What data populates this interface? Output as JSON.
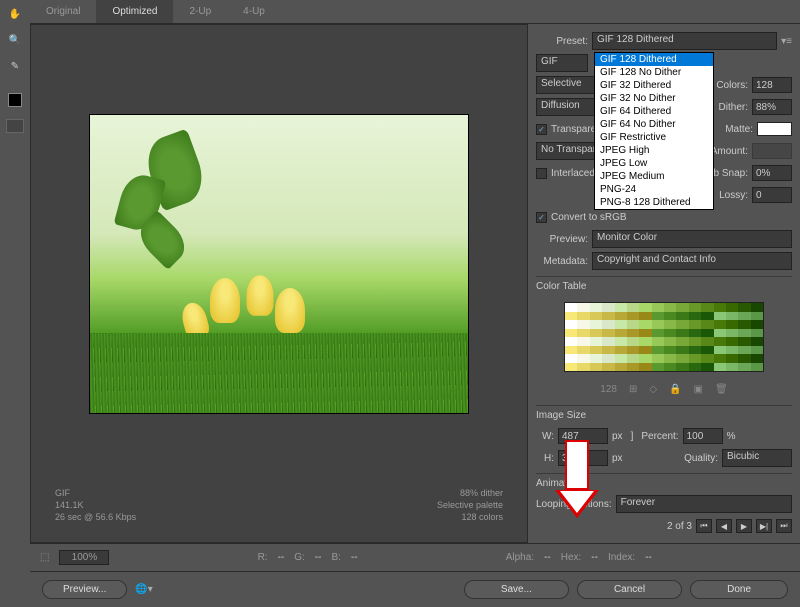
{
  "tabs": [
    "Original",
    "Optimized",
    "2-Up",
    "4-Up"
  ],
  "active_tab": "Optimized",
  "preset": {
    "label": "Preset:",
    "value": "GIF 128 Dithered",
    "options": [
      "GIF 128 Dithered",
      "GIF 128 No Dither",
      "GIF 32 Dithered",
      "GIF 32 No Dither",
      "GIF 64 Dithered",
      "GIF 64 No Dither",
      "GIF Restrictive",
      "JPEG High",
      "JPEG Low",
      "JPEG Medium",
      "PNG-24",
      "PNG-8 128 Dithered"
    ]
  },
  "format_label": "GIF",
  "palette": {
    "label": "Selective",
    "colors_label": "Colors:",
    "colors": "128"
  },
  "dither": {
    "label": "Diffusion",
    "dither_label": "Dither:",
    "value": "88%"
  },
  "transparency": {
    "label": "Transparency",
    "checked": true,
    "matte_label": "Matte:"
  },
  "transparency_dither": {
    "label": "No Transparency Dither",
    "amount_label": "Amount:"
  },
  "interlaced": {
    "label": "Interlaced",
    "checked": false,
    "websnap_label": "Web Snap:",
    "websnap": "0%"
  },
  "lossy": {
    "label": "Lossy:",
    "value": "0"
  },
  "srgb": {
    "label": "Convert to sRGB",
    "checked": true
  },
  "preview": {
    "label": "Preview:",
    "value": "Monitor Color"
  },
  "metadata": {
    "label": "Metadata:",
    "value": "Copyright and Contact Info"
  },
  "color_table": {
    "title": "Color Table",
    "count": "128"
  },
  "image_size": {
    "title": "Image Size",
    "w_label": "W:",
    "w": "487",
    "px": "px",
    "h_label": "H:",
    "h": "368",
    "percent_label": "Percent:",
    "percent": "100",
    "percent_unit": "%",
    "quality_label": "Quality:",
    "quality": "Bicubic"
  },
  "animation": {
    "title": "Animation",
    "options_label": "Looping Options:",
    "options": "Forever",
    "frame_info": "2 of 3"
  },
  "info": {
    "format": "GIF",
    "size": "141.1K",
    "speed": "26 sec @ 56.6 Kbps",
    "dither": "88% dither",
    "palette": "Selective palette",
    "colors": "128 colors"
  },
  "bottom": {
    "zoom": "100%",
    "r_label": "R:",
    "g_label": "G:",
    "b_label": "B:",
    "alpha_label": "Alpha:",
    "hex_label": "Hex:",
    "index_label": "Index:"
  },
  "buttons": {
    "preview": "Preview...",
    "save": "Save...",
    "cancel": "Cancel",
    "done": "Done"
  }
}
